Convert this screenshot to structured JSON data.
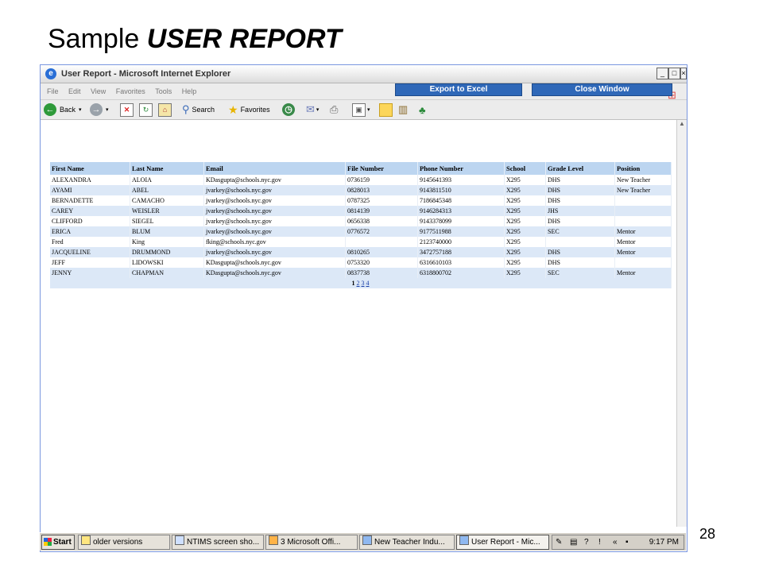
{
  "slide": {
    "title_plain": "Sample ",
    "title_bold": "USER REPORT",
    "page_number": "28"
  },
  "window": {
    "title": "User Report - Microsoft Internet Explorer",
    "menu": [
      "File",
      "Edit",
      "View",
      "Favorites",
      "Tools",
      "Help"
    ],
    "toolbar": {
      "back_label": "Back",
      "search_label": "Search",
      "favorites_label": "Favorites"
    }
  },
  "report": {
    "export_label": "Export to Excel",
    "close_label": "Close Window",
    "columns": [
      "First Name",
      "Last Name",
      "Email",
      "File Number",
      "Phone Number",
      "School",
      "Grade Level",
      "Position"
    ],
    "rows": [
      [
        "ALEXANDRA",
        "ALOIA",
        "KDasgupta@schools.nyc.gov",
        "0736159",
        "9145641393",
        "X295",
        "DHS",
        "New Teacher"
      ],
      [
        "AYAMI",
        "ABEL",
        "jvarkey@schools.nyc.gov",
        "0828013",
        "9143811510",
        "X295",
        "DHS",
        "New Teacher"
      ],
      [
        "BERNADETTE",
        "CAMACHO",
        "jvarkey@schools.nyc.gov",
        "0787325",
        "7186845348",
        "X295",
        "DHS",
        ""
      ],
      [
        "CAREY",
        "WEISLER",
        "jvarkey@schools.nyc.gov",
        "0814139",
        "9146284313",
        "X295",
        "JHS",
        ""
      ],
      [
        "CLIFFORD",
        "SIEGEL",
        "jvarkey@schools.nyc.gov",
        "0656338",
        "9143378099",
        "X295",
        "DHS",
        ""
      ],
      [
        "ERICA",
        "BLUM",
        "jvarkey@schools.nyc.gov",
        "0776572",
        "9177511988",
        "X295",
        "SEC",
        "Mentor"
      ],
      [
        "Fred",
        "King",
        "fking@schools.nyc.gov",
        "",
        "2123740000",
        "X295",
        "",
        "Mentor"
      ],
      [
        "JACQUELINE",
        "DRUMMOND",
        "jvarkey@schools.nyc.gov",
        "0810265",
        "3472757188",
        "X295",
        "DHS",
        "Mentor"
      ],
      [
        "JEFF",
        "LIDOWSKI",
        "KDasgupta@schools.nyc.gov",
        "0753320",
        "6316610103",
        "X295",
        "DHS",
        ""
      ],
      [
        "JENNY",
        "CHAPMAN",
        "KDasgupta@schools.nyc.gov",
        "0837738",
        "6318800702",
        "X295",
        "SEC",
        "Mentor"
      ]
    ],
    "pages": [
      "1",
      "2",
      "3",
      "4"
    ],
    "current_page": "1"
  },
  "taskbar": {
    "start_label": "Start",
    "tasks": [
      "older versions",
      "NTIMS screen sho...",
      "3 Microsoft Offi...",
      "New Teacher Indu...",
      "User Report - Mic..."
    ],
    "clock": "9:17 PM"
  }
}
